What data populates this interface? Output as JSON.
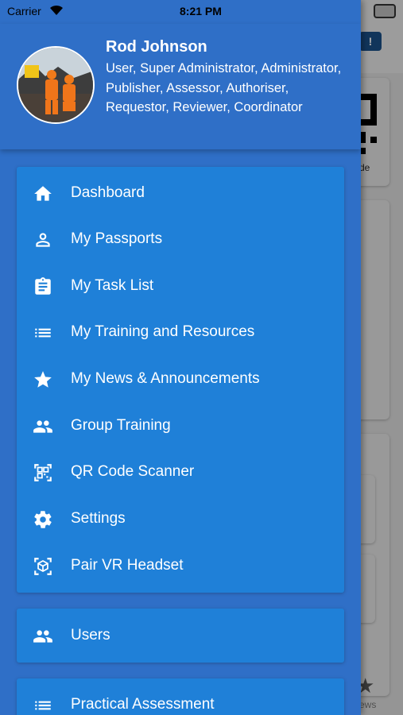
{
  "status_bar": {
    "carrier": "Carrier",
    "time": "8:21 PM"
  },
  "background": {
    "badge": "!",
    "qr_label": "de",
    "tab_label": "ews"
  },
  "profile": {
    "name": "Rod Johnson",
    "roles": "User, Super Administrator, Administrator, Publisher, Assessor, Authoriser, Requestor, Reviewer, Coordinator"
  },
  "menu": {
    "main": [
      {
        "label": "Dashboard",
        "icon": "home-icon"
      },
      {
        "label": "My Passports",
        "icon": "person-icon"
      },
      {
        "label": "My Task List",
        "icon": "clipboard-icon"
      },
      {
        "label": "My Training and Resources",
        "icon": "list-icon"
      },
      {
        "label": "My News & Announcements",
        "icon": "star-icon"
      },
      {
        "label": "Group Training",
        "icon": "group-icon"
      },
      {
        "label": "QR Code Scanner",
        "icon": "qr-scan-icon"
      },
      {
        "label": "Settings",
        "icon": "gear-icon"
      },
      {
        "label": "Pair VR Headset",
        "icon": "vr-headset-icon"
      }
    ],
    "admin": [
      {
        "label": "Users",
        "icon": "group-icon"
      }
    ],
    "assessment": [
      {
        "label": "Practical Assessment",
        "icon": "list-icon"
      }
    ]
  },
  "colors": {
    "drawer_bg": "#2f6fc7",
    "card_bg": "#1f80d8",
    "text": "#ffffff"
  }
}
